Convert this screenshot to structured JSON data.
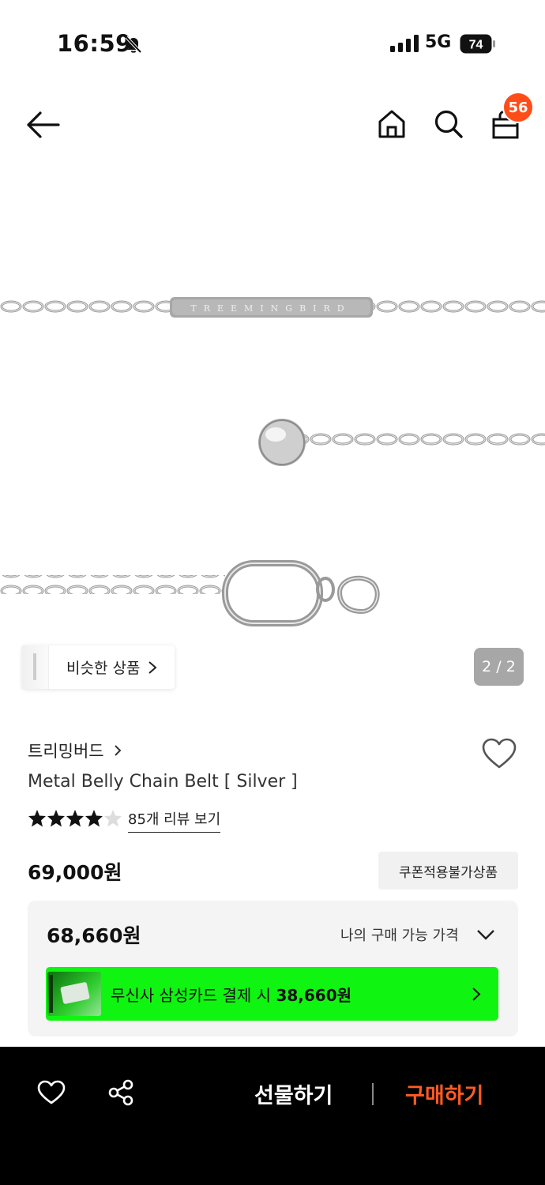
{
  "status_bar": {
    "time": "16:59",
    "network": "5G",
    "battery": "74"
  },
  "nav": {
    "cart_count": "56"
  },
  "gallery": {
    "similar_label": "비슷한 상품",
    "counter": "2 / 2",
    "engraving": "TREEMINGBIRD"
  },
  "product": {
    "brand": "트리밍버드",
    "name": "Metal Belly Chain Belt [ Silver ]",
    "rating": 4.5,
    "review_link": "85개 리뷰 보기",
    "original_price": "69,000원",
    "coupon_badge": "쿠폰적용불가상품",
    "my_price": "68,660원",
    "my_price_label": "나의 구매 가능 가격",
    "card_offer_prefix": "무신사 삼성카드 결제 시 ",
    "card_offer_price": "38,660원"
  },
  "bottom_bar": {
    "gift_label": "선물하기",
    "buy_label": "구매하기"
  },
  "colors": {
    "accent_orange": "#ff5b22",
    "badge_orange": "#ff4d1a",
    "card_green": "#10f412"
  }
}
